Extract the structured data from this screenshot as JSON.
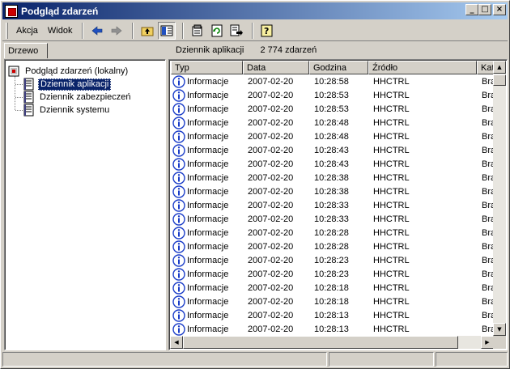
{
  "window": {
    "title": "Podgląd zdarzeń"
  },
  "titlebar_buttons": {
    "minimize": "_",
    "maximize": "□",
    "close": "×"
  },
  "menu": {
    "action": "Akcja",
    "view": "Widok"
  },
  "toolbar": {
    "icons": [
      "back-arrow-icon",
      "forward-arrow-icon",
      "up-folder-icon",
      "show-hide-tree-icon",
      "properties-icon",
      "refresh-icon",
      "export-list-icon",
      "help-icon"
    ]
  },
  "tree_tab": {
    "label": "Drzewo"
  },
  "list_header": {
    "log_name": "Dziennik aplikacji",
    "event_count": "2 774 zdarzeń"
  },
  "tree": {
    "root": "Podgląd zdarzeń (lokalny)",
    "nodes": [
      "Dziennik aplikacji",
      "Dziennik zabezpieczeń",
      "Dziennik systemu"
    ],
    "selected": "Dziennik aplikacji"
  },
  "columns": [
    "Typ",
    "Data",
    "Godzina",
    "Źródło",
    "Kat"
  ],
  "rows": [
    {
      "type": "Informacje",
      "date": "2007-02-20",
      "time": "10:28:58",
      "source": "HHCTRL",
      "cat": "Bra"
    },
    {
      "type": "Informacje",
      "date": "2007-02-20",
      "time": "10:28:53",
      "source": "HHCTRL",
      "cat": "Bra"
    },
    {
      "type": "Informacje",
      "date": "2007-02-20",
      "time": "10:28:53",
      "source": "HHCTRL",
      "cat": "Bra"
    },
    {
      "type": "Informacje",
      "date": "2007-02-20",
      "time": "10:28:48",
      "source": "HHCTRL",
      "cat": "Bra"
    },
    {
      "type": "Informacje",
      "date": "2007-02-20",
      "time": "10:28:48",
      "source": "HHCTRL",
      "cat": "Bra"
    },
    {
      "type": "Informacje",
      "date": "2007-02-20",
      "time": "10:28:43",
      "source": "HHCTRL",
      "cat": "Bra"
    },
    {
      "type": "Informacje",
      "date": "2007-02-20",
      "time": "10:28:43",
      "source": "HHCTRL",
      "cat": "Bra"
    },
    {
      "type": "Informacje",
      "date": "2007-02-20",
      "time": "10:28:38",
      "source": "HHCTRL",
      "cat": "Bra"
    },
    {
      "type": "Informacje",
      "date": "2007-02-20",
      "time": "10:28:38",
      "source": "HHCTRL",
      "cat": "Bra"
    },
    {
      "type": "Informacje",
      "date": "2007-02-20",
      "time": "10:28:33",
      "source": "HHCTRL",
      "cat": "Bra"
    },
    {
      "type": "Informacje",
      "date": "2007-02-20",
      "time": "10:28:33",
      "source": "HHCTRL",
      "cat": "Bra"
    },
    {
      "type": "Informacje",
      "date": "2007-02-20",
      "time": "10:28:28",
      "source": "HHCTRL",
      "cat": "Bra"
    },
    {
      "type": "Informacje",
      "date": "2007-02-20",
      "time": "10:28:28",
      "source": "HHCTRL",
      "cat": "Bra"
    },
    {
      "type": "Informacje",
      "date": "2007-02-20",
      "time": "10:28:23",
      "source": "HHCTRL",
      "cat": "Bra"
    },
    {
      "type": "Informacje",
      "date": "2007-02-20",
      "time": "10:28:23",
      "source": "HHCTRL",
      "cat": "Bra"
    },
    {
      "type": "Informacje",
      "date": "2007-02-20",
      "time": "10:28:18",
      "source": "HHCTRL",
      "cat": "Bra"
    },
    {
      "type": "Informacje",
      "date": "2007-02-20",
      "time": "10:28:18",
      "source": "HHCTRL",
      "cat": "Bra"
    },
    {
      "type": "Informacje",
      "date": "2007-02-20",
      "time": "10:28:13",
      "source": "HHCTRL",
      "cat": "Bra"
    },
    {
      "type": "Informacje",
      "date": "2007-02-20",
      "time": "10:28:13",
      "source": "HHCTRL",
      "cat": "Bra"
    }
  ],
  "colors": {
    "title_start": "#0a246a",
    "title_end": "#a6caf0",
    "face": "#d4d0c8",
    "selection": "#0a246a",
    "info_icon": "#1a3cc8"
  }
}
